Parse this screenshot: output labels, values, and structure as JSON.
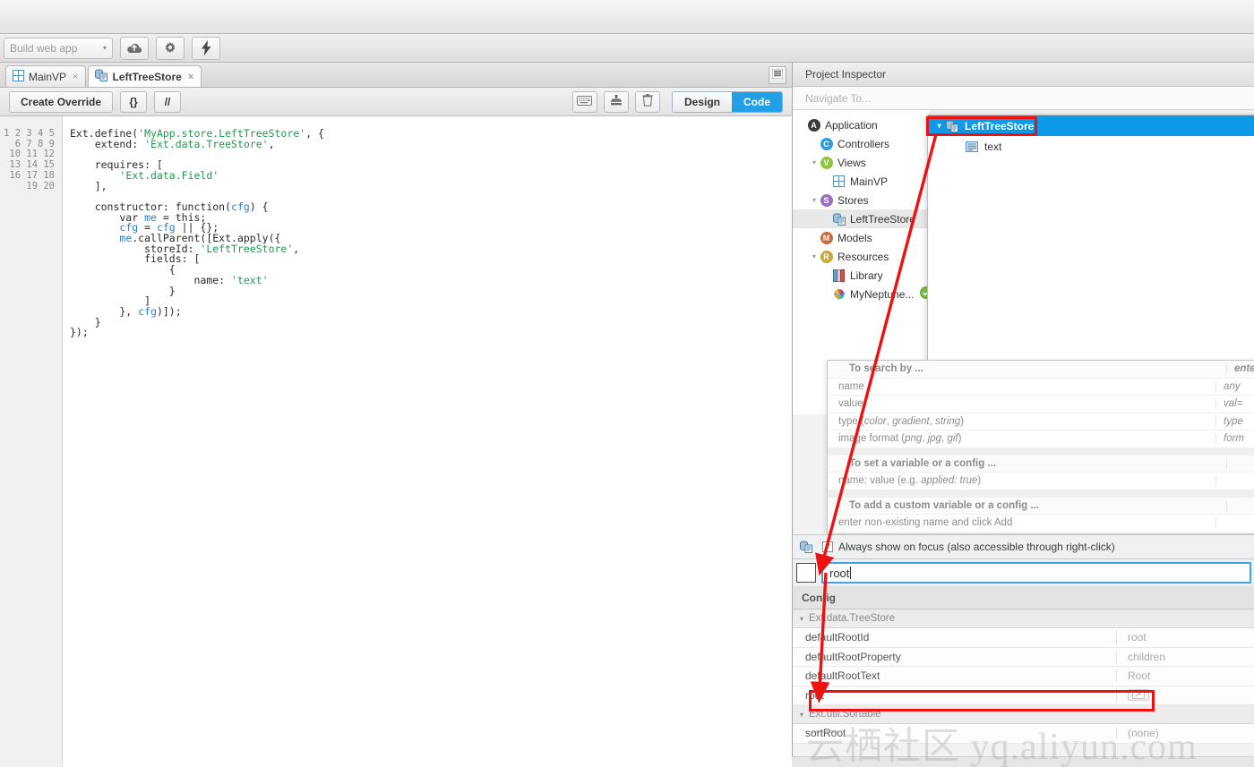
{
  "toolbar": {
    "build_target": "Build web app",
    "caret": "▾",
    "deploy_icon": "cloud-upload-icon",
    "settings_icon": "gear-icon",
    "run_icon": "lightning-bolt-icon"
  },
  "tabs": [
    {
      "label": "MainVP",
      "icon": "view-grid-icon",
      "active": false,
      "close": "×"
    },
    {
      "label": "LeftTreeStore",
      "icon": "store-icon",
      "active": true,
      "close": "×"
    }
  ],
  "tabbar": {
    "menu_icon": "list-menu-icon"
  },
  "editor_toolbar": {
    "create_override": "Create Override",
    "braces": "{}",
    "comment": "//",
    "keyboard_icon": "keyboard-icon",
    "save_icon": "save-stamp-icon",
    "delete_icon": "trash-icon",
    "design_label": "Design",
    "code_label": "Code",
    "active_mode": "Code",
    "accent": "#21a0e8"
  },
  "editor": {
    "line_numbers": [
      1,
      2,
      3,
      4,
      5,
      6,
      7,
      8,
      9,
      10,
      11,
      12,
      13,
      14,
      15,
      16,
      17,
      18,
      19,
      20
    ],
    "lines": [
      "Ext.define('MyApp.store.LeftTreeStore', {",
      "    extend: 'Ext.data.TreeStore',",
      "",
      "    requires: [",
      "        'Ext.data.Field'",
      "    ],",
      "",
      "    constructor: function(cfg) {",
      "        var me = this;",
      "        cfg = cfg || {};",
      "        me.callParent([Ext.apply({",
      "            storeId: 'LeftTreeStore',",
      "            fields: [",
      "                {",
      "                    name: 'text'",
      "                }",
      "            ]",
      "        }, cfg)]);",
      "    }",
      "});"
    ]
  },
  "inspector": {
    "title": "Project Inspector",
    "navigate_placeholder": "Navigate To...",
    "tree": [
      {
        "label": "Application",
        "icon": "application-badge-icon",
        "badge": "A",
        "badge_class": "b-app",
        "indent": 0,
        "twisty": ""
      },
      {
        "label": "Controllers",
        "icon": "controllers-badge-icon",
        "badge": "C",
        "badge_class": "b-ctrl",
        "indent": 1,
        "twisty": ""
      },
      {
        "label": "Views",
        "icon": "views-badge-icon",
        "badge": "V",
        "badge_class": "b-views",
        "indent": 1,
        "twisty": "▾"
      },
      {
        "label": "MainVP",
        "icon": "view-grid-icon",
        "badge": "",
        "badge_class": "",
        "indent": 2,
        "twisty": ""
      },
      {
        "label": "Stores",
        "icon": "stores-badge-icon",
        "badge": "S",
        "badge_class": "b-stores",
        "indent": 1,
        "twisty": "▾"
      },
      {
        "label": "LeftTreeStore",
        "icon": "store-icon",
        "badge": "",
        "badge_class": "",
        "indent": 2,
        "twisty": "",
        "selected": true
      },
      {
        "label": "Models",
        "icon": "models-badge-icon",
        "badge": "M",
        "badge_class": "b-models",
        "indent": 1,
        "twisty": ""
      },
      {
        "label": "Resources",
        "icon": "resources-badge-icon",
        "badge": "R",
        "badge_class": "b-res",
        "indent": 1,
        "twisty": "▾"
      },
      {
        "label": "Library",
        "icon": "library-book-icon",
        "badge": "",
        "badge_class": "",
        "indent": 2,
        "twisty": ""
      },
      {
        "label": "MyNeptune...",
        "icon": "theme-palette-icon",
        "badge": "",
        "badge_class": "",
        "indent": 2,
        "twisty": "",
        "status": "check-circle-icon"
      }
    ]
  },
  "overlay_tree": {
    "rows": [
      {
        "label": "LeftTreeStore",
        "icon": "store-icon",
        "twisty": "▾",
        "selected": true,
        "indent": 0
      },
      {
        "label": "text",
        "icon": "field-icon",
        "twisty": "",
        "selected": false,
        "indent": 1
      }
    ]
  },
  "help": {
    "sections": [
      {
        "title": "To search by ...",
        "title_right": "enter",
        "rows": [
          {
            "left": "name",
            "right": "any"
          },
          {
            "left": "value",
            "right": "val="
          },
          {
            "left": "type (color, gradient, string)",
            "right": "type"
          },
          {
            "left": "image format (png, jpg, gif)",
            "right": "form"
          }
        ]
      },
      {
        "title": "To set a variable or a config ...",
        "title_right": "",
        "rows": [
          {
            "left": "name: value (e.g. applied: true)",
            "right": ""
          }
        ]
      },
      {
        "title": "To add a custom variable or a config ...",
        "title_right": "",
        "rows": [
          {
            "left": "enter non-existing name and click Add",
            "right": ""
          }
        ]
      }
    ]
  },
  "focus_row": {
    "checkbox_checked": true,
    "checkbox_glyph": "✓",
    "label": "Always show on focus (also accessible through right-click)",
    "store_icon": "store-icon"
  },
  "search_field": {
    "value": "root",
    "has_cursor": true,
    "side_checkbox_checked": false
  },
  "config": {
    "header": "Config",
    "groups": [
      {
        "name": "Ext.data.TreeStore",
        "twisty": "▾",
        "rows": [
          {
            "key": "defaultRootId",
            "value": "root"
          },
          {
            "key": "defaultRootProperty",
            "value": "children"
          },
          {
            "key": "defaultRootText",
            "value": "Root"
          },
          {
            "key": "root",
            "value": "",
            "has_edit_button": true,
            "highlighted": true
          }
        ]
      },
      {
        "name": "Ext.util.Sortable",
        "twisty": "▾",
        "rows": [
          {
            "key": "sortRoot",
            "value": "(none)"
          }
        ]
      }
    ]
  },
  "annotations": {
    "color": "#ee1111",
    "boxes": [
      {
        "name": "leftreestore-highlight-box"
      },
      {
        "name": "root-config-row-box"
      }
    ],
    "arrows": [
      {
        "name": "arrow-to-search-field"
      },
      {
        "name": "arrow-to-root-config-row"
      }
    ]
  },
  "watermark": {
    "text": "云栖社区 yq.aliyun.com"
  }
}
